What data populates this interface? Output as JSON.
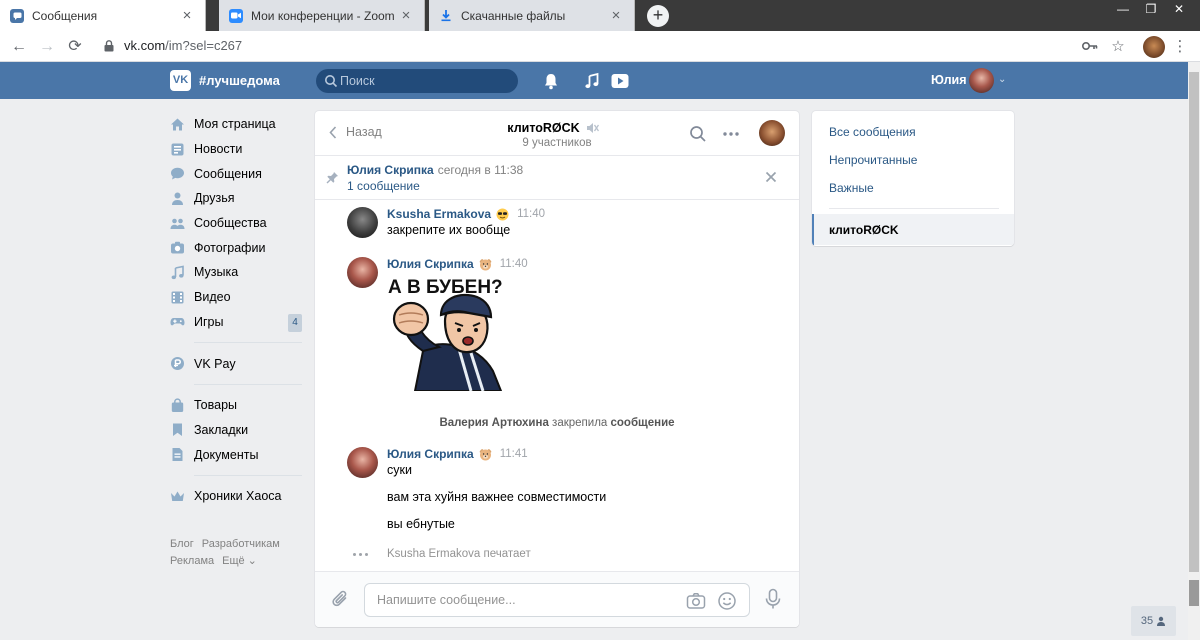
{
  "browser": {
    "tabs": [
      {
        "title": "Сообщения",
        "active": true,
        "favicon_color": "#4a76a8"
      },
      {
        "title": "Мои конференции - Zoom",
        "active": false,
        "favicon_color": "#2d8cff"
      },
      {
        "title": "Скачанные файлы",
        "active": false,
        "favicon_color": "#1a73e8"
      }
    ],
    "url_host": "vk.com",
    "url_path": "/im?sel=c267"
  },
  "header": {
    "brand": "#лучшедома",
    "logo": "VK",
    "search_placeholder": "Поиск",
    "user_name": "Юлия",
    "accent_color": "#4a76a8"
  },
  "left_nav": {
    "groups": [
      [
        {
          "label": "Моя страница",
          "icon": "home-icon"
        },
        {
          "label": "Новости",
          "icon": "news-icon"
        },
        {
          "label": "Сообщения",
          "icon": "messages-icon"
        },
        {
          "label": "Друзья",
          "icon": "friends-icon"
        },
        {
          "label": "Сообщества",
          "icon": "communities-icon"
        },
        {
          "label": "Фотографии",
          "icon": "camera-icon"
        },
        {
          "label": "Музыка",
          "icon": "music-icon"
        },
        {
          "label": "Видео",
          "icon": "video-icon"
        },
        {
          "label": "Игры",
          "icon": "gamepad-icon",
          "badge": "4"
        }
      ],
      [
        {
          "label": "VK Pay",
          "icon": "vkpay-icon"
        }
      ],
      [
        {
          "label": "Товары",
          "icon": "bag-icon"
        },
        {
          "label": "Закладки",
          "icon": "bookmark-icon"
        },
        {
          "label": "Документы",
          "icon": "document-icon"
        }
      ],
      [
        {
          "label": "Хроники Хаоса",
          "icon": "crown-icon"
        }
      ]
    ],
    "footer_row1": [
      "Блог",
      "Разработчикам"
    ],
    "footer_row2": [
      "Реклама",
      "Ещё ⌄"
    ]
  },
  "chat": {
    "back_label": "Назад",
    "title": "клитоRØCK",
    "subtitle": "9 участников",
    "pinned": {
      "author": "Юлия Скрипка",
      "time": "сегодня в 11:38",
      "text": "1 сообщение"
    },
    "messages": [
      {
        "author": "Ksusha Ermakova",
        "time": "11:40",
        "lines": [
          "закрепите их вообще"
        ]
      },
      {
        "author": "Юлия Скрипка",
        "time": "11:40",
        "sticker_text": "А В БУБЕН?"
      },
      {
        "author": "Юлия Скрипка",
        "time": "11:41",
        "lines": [
          "суки",
          "вам эта хуйня важнее совместимости",
          "вы ебнутые"
        ]
      }
    ],
    "system": {
      "actor": "Валерия Артюхина",
      "action": "закрепила",
      "object": "сообщение"
    },
    "typing": "Ksusha Ermakova печатает",
    "composer_placeholder": "Напишите сообщение..."
  },
  "right_panel": {
    "items": [
      "Все сообщения",
      "Непрочитанные",
      "Важные"
    ],
    "selected": "клитоRØCK"
  },
  "online_counter": "35"
}
